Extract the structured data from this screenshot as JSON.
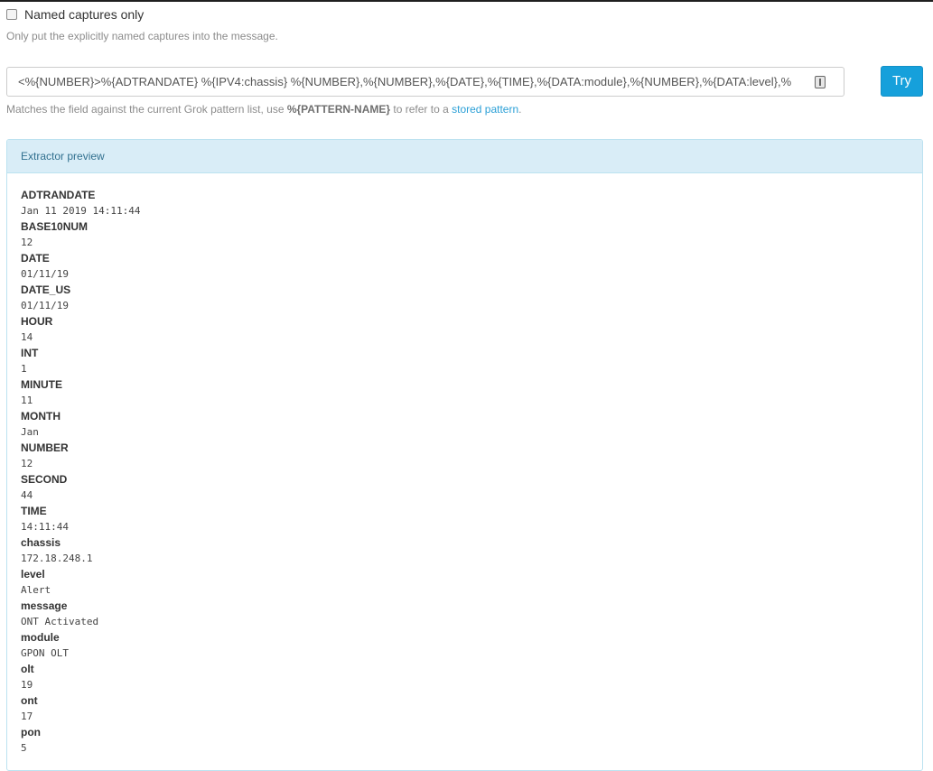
{
  "named_captures": {
    "label": "Named captures only",
    "checked": false,
    "help": "Only put the explicitly named captures into the message."
  },
  "pattern": {
    "value": "<%{NUMBER}>%{ADTRANDATE} %{IPV4:chassis} %{NUMBER},%{NUMBER},%{DATE},%{TIME},%{DATA:module},%{NUMBER},%{DATA:level},%"
  },
  "try_button": {
    "label": "Try"
  },
  "pattern_help": {
    "prefix": "Matches the field against the current Grok pattern list, use ",
    "token": "%{PATTERN-NAME}",
    "middle": " to refer to a ",
    "link": "stored pattern",
    "suffix": "."
  },
  "preview": {
    "title": "Extractor preview",
    "fields": [
      {
        "name": "ADTRANDATE",
        "value": "Jan 11 2019 14:11:44"
      },
      {
        "name": "BASE10NUM",
        "value": "12"
      },
      {
        "name": "DATE",
        "value": "01/11/19"
      },
      {
        "name": "DATE_US",
        "value": "01/11/19"
      },
      {
        "name": "HOUR",
        "value": "14"
      },
      {
        "name": "INT",
        "value": "1"
      },
      {
        "name": "MINUTE",
        "value": "11"
      },
      {
        "name": "MONTH",
        "value": "Jan"
      },
      {
        "name": "NUMBER",
        "value": "12"
      },
      {
        "name": "SECOND",
        "value": "44"
      },
      {
        "name": "TIME",
        "value": "14:11:44"
      },
      {
        "name": "chassis",
        "value": "172.18.248.1"
      },
      {
        "name": "level",
        "value": "Alert"
      },
      {
        "name": "message",
        "value": "ONT Activated"
      },
      {
        "name": "module",
        "value": "GPON OLT"
      },
      {
        "name": "olt",
        "value": "19"
      },
      {
        "name": "ont",
        "value": "17"
      },
      {
        "name": "pon",
        "value": "5"
      }
    ]
  }
}
